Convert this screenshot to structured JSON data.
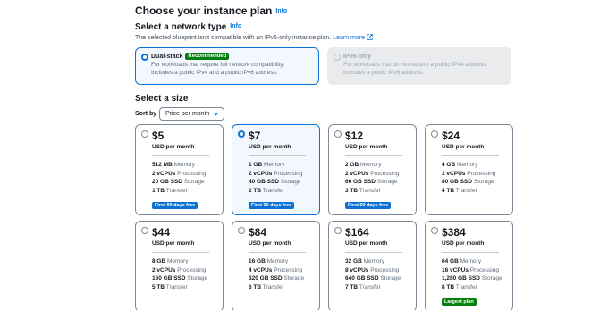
{
  "page": {
    "title": "Choose your instance plan",
    "info": "Info"
  },
  "network": {
    "heading": "Select a network type",
    "info": "Info",
    "description": "The selected blueprint isn't compatible with an IPv6-only instance plan.",
    "learn_more": "Learn more",
    "options": [
      {
        "label": "Dual-stack",
        "badge": "Recommended",
        "line1": "For workloads that require full network compatibility.",
        "line2": "Includes a public IPv4 and a public IPv6 address.",
        "selected": true
      },
      {
        "label": "IPv6-only",
        "line1": "For workloads that do not require a public IPv4 address.",
        "line2": "Includes a public IPv6 address.",
        "disabled": true
      }
    ]
  },
  "size": {
    "heading": "Select a size",
    "sort_label": "Sort by",
    "sort_value": "Price per month"
  },
  "plans": [
    {
      "price": "$5",
      "per": "USD per month",
      "mem": "512 MB",
      "mem_u": "Memory",
      "cpu": "2 vCPUs",
      "cpu_u": "Processing",
      "ssd": "20 GB SSD",
      "ssd_u": "Storage",
      "tr": "1 TB",
      "tr_u": "Transfer",
      "badge": "First 90 days free"
    },
    {
      "price": "$7",
      "per": "USD per month",
      "mem": "1 GB",
      "mem_u": "Memory",
      "cpu": "2 vCPUs",
      "cpu_u": "Processing",
      "ssd": "40 GB SSD",
      "ssd_u": "Storage",
      "tr": "2 TB",
      "tr_u": "Transfer",
      "badge": "First 90 days free",
      "selected": true
    },
    {
      "price": "$12",
      "per": "USD per month",
      "mem": "2 GB",
      "mem_u": "Memory",
      "cpu": "2 vCPUs",
      "cpu_u": "Processing",
      "ssd": "60 GB SSD",
      "ssd_u": "Storage",
      "tr": "3 TB",
      "tr_u": "Transfer",
      "badge": "First 90 days free"
    },
    {
      "price": "$24",
      "per": "USD per month",
      "mem": "4 GB",
      "mem_u": "Memory",
      "cpu": "2 vCPUs",
      "cpu_u": "Processing",
      "ssd": "80 GB SSD",
      "ssd_u": "Storage",
      "tr": "4 TB",
      "tr_u": "Transfer"
    },
    {
      "price": "$44",
      "per": "USD per month",
      "mem": "8 GB",
      "mem_u": "Memory",
      "cpu": "2 vCPUs",
      "cpu_u": "Processing",
      "ssd": "160 GB SSD",
      "ssd_u": "Storage",
      "tr": "5 TB",
      "tr_u": "Transfer"
    },
    {
      "price": "$84",
      "per": "USD per month",
      "mem": "16 GB",
      "mem_u": "Memory",
      "cpu": "4 vCPUs",
      "cpu_u": "Processing",
      "ssd": "320 GB SSD",
      "ssd_u": "Storage",
      "tr": "6 TB",
      "tr_u": "Transfer"
    },
    {
      "price": "$164",
      "per": "USD per month",
      "mem": "32 GB",
      "mem_u": "Memory",
      "cpu": "8 vCPUs",
      "cpu_u": "Processing",
      "ssd": "640 GB SSD",
      "ssd_u": "Storage",
      "tr": "7 TB",
      "tr_u": "Transfer"
    },
    {
      "price": "$384",
      "per": "USD per month",
      "mem": "64 GB",
      "mem_u": "Memory",
      "cpu": "16 vCPUs",
      "cpu_u": "Processing",
      "ssd": "1,280 GB SSD",
      "ssd_u": "Storage",
      "tr": "8 TB",
      "tr_u": "Transfer",
      "badge": "Largest plan"
    }
  ],
  "colors": {
    "accent": "#0972d3",
    "recommended_badge": "#037f0c",
    "selected_bg": "#f2f8fd"
  },
  "icons": {
    "external": "external-link-icon",
    "caret": "caret-down-icon"
  }
}
